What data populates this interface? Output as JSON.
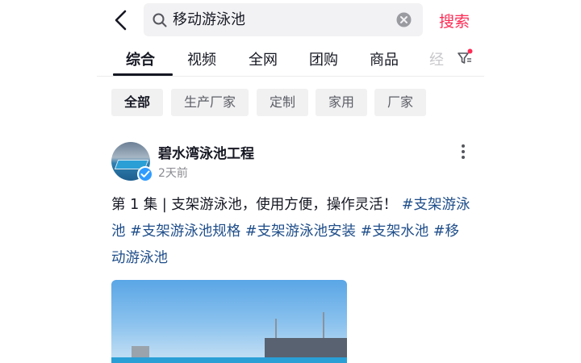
{
  "search": {
    "query": "移动游泳池",
    "button_label": "搜索"
  },
  "tabs": [
    {
      "label": "综合",
      "active": true
    },
    {
      "label": "视频"
    },
    {
      "label": "全网"
    },
    {
      "label": "团购"
    },
    {
      "label": "商品"
    },
    {
      "label": "经"
    }
  ],
  "chips": [
    {
      "label": "全部",
      "active": true
    },
    {
      "label": "生产厂家"
    },
    {
      "label": "定制"
    },
    {
      "label": "家用"
    },
    {
      "label": "厂家"
    }
  ],
  "post": {
    "author": "碧水湾泳池工程",
    "time": "2天前",
    "caption_text": "第 1 集 | 支架游泳池，使用方便，操作灵活！",
    "hashtags": [
      "#支架游泳池",
      "#支架游泳池规格",
      "#支架游泳池安装",
      "#支架水池",
      "#移动游泳池"
    ]
  },
  "colors": {
    "accent": "#fe2c55",
    "hashtag": "#1f4e8a",
    "verified": "#2f9bff"
  }
}
